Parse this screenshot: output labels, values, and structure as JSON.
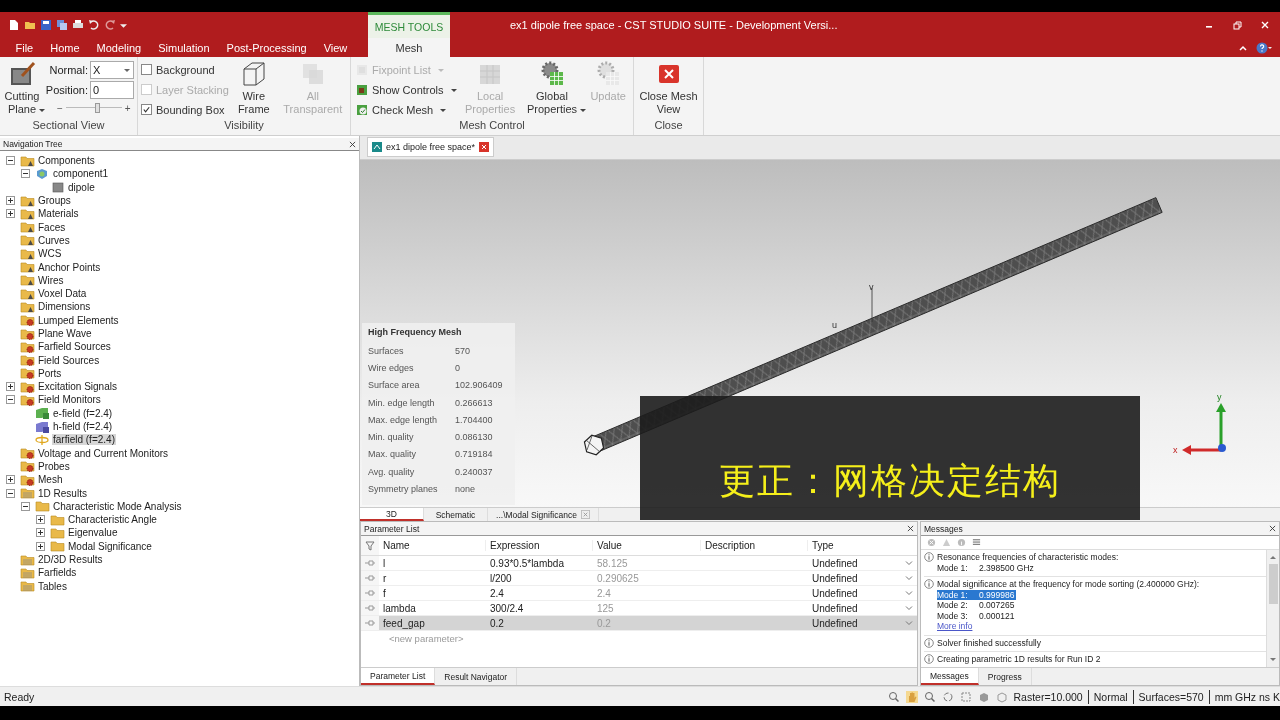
{
  "window": {
    "title": "ex1 dipole free space - CST STUDIO SUITE - Development Versi..."
  },
  "ribbon_tabs": [
    {
      "label": "File",
      "selected": false
    },
    {
      "label": "Home",
      "selected": false
    },
    {
      "label": "Modeling",
      "selected": false
    },
    {
      "label": "Simulation",
      "selected": false
    },
    {
      "label": "Post-Processing",
      "selected": false
    },
    {
      "label": "View",
      "selected": false
    }
  ],
  "contextual_group": {
    "label": "MESH TOOLS",
    "tabs": [
      {
        "label": "Mesh",
        "selected": true
      }
    ]
  },
  "ribbon": [
    {
      "label": "Sectional View",
      "items": [
        {
          "kind": "large-button",
          "label": "Cutting Plane",
          "menu": true,
          "disabled": false
        },
        {
          "kind": "field",
          "label": "Normal:",
          "value": "X",
          "menu": true
        },
        {
          "kind": "field",
          "label": "Position:",
          "value": "0",
          "menu": false
        },
        {
          "kind": "slider",
          "decrease": "−",
          "increase": "+",
          "level": 0.55
        }
      ]
    },
    {
      "label": "Visibility",
      "items": [
        {
          "kind": "checkbox",
          "label": "Background",
          "checked": false,
          "disabled": false
        },
        {
          "kind": "checkbox",
          "label": "Layer Stacking",
          "checked": false,
          "disabled": true
        },
        {
          "kind": "checkbox",
          "label": "Bounding Box",
          "checked": true,
          "disabled": false
        },
        {
          "kind": "large-button",
          "label": "Wire Frame",
          "menu": false,
          "disabled": false
        },
        {
          "kind": "large-button",
          "label": "All Transparent",
          "menu": false,
          "disabled": true
        }
      ]
    },
    {
      "label": "Mesh Control",
      "items": [
        {
          "kind": "small-button",
          "label": "Fixpoint List",
          "menu": true,
          "disabled": true
        },
        {
          "kind": "small-button",
          "label": "Show Controls",
          "menu": true,
          "disabled": false
        },
        {
          "kind": "small-button",
          "label": "Check Mesh",
          "menu": true,
          "disabled": false
        },
        {
          "kind": "large-button",
          "label": "Local Properties",
          "menu": false,
          "disabled": true
        },
        {
          "kind": "large-button",
          "label": "Global Properties",
          "menu": true,
          "disabled": false
        },
        {
          "kind": "large-button",
          "label": "Update",
          "menu": false,
          "disabled": true
        }
      ]
    },
    {
      "label": "Close",
      "items": [
        {
          "kind": "large-button",
          "label": "Close Mesh View",
          "menu": false,
          "disabled": false
        }
      ]
    }
  ],
  "navigation_tree": {
    "title": "Navigation Tree",
    "items": [
      {
        "label": "Components",
        "kind": "folder",
        "expanded": true,
        "selected": false,
        "children": [
          {
            "label": "component1",
            "kind": "component",
            "expanded": true,
            "selected": false,
            "children": [
              {
                "label": "dipole",
                "kind": "solid",
                "selected": false
              }
            ]
          }
        ]
      },
      {
        "label": "Groups",
        "kind": "folder",
        "expanded": false,
        "selected": false
      },
      {
        "label": "Materials",
        "kind": "folder",
        "expanded": false,
        "selected": false
      },
      {
        "label": "Faces",
        "kind": "folder",
        "selected": false
      },
      {
        "label": "Curves",
        "kind": "folder",
        "selected": false
      },
      {
        "label": "WCS",
        "kind": "folder",
        "selected": false
      },
      {
        "label": "Anchor Points",
        "kind": "folder",
        "selected": false
      },
      {
        "label": "Wires",
        "kind": "folder",
        "selected": false
      },
      {
        "label": "Voxel Data",
        "kind": "folder",
        "selected": false
      },
      {
        "label": "Dimensions",
        "kind": "folder",
        "selected": false
      },
      {
        "label": "Lumped Elements",
        "kind": "source-folder",
        "selected": false
      },
      {
        "label": "Plane Wave",
        "kind": "source-folder",
        "selected": false
      },
      {
        "label": "Farfield Sources",
        "kind": "source-folder",
        "selected": false
      },
      {
        "label": "Field Sources",
        "kind": "source-folder",
        "selected": false
      },
      {
        "label": "Ports",
        "kind": "source-folder",
        "selected": false
      },
      {
        "label": "Excitation Signals",
        "kind": "source-folder",
        "expanded": false,
        "selected": false
      },
      {
        "label": "Field Monitors",
        "kind": "source-folder",
        "expanded": true,
        "selected": false,
        "children": [
          {
            "label": "e-field (f=2.4)",
            "kind": "e-monitor",
            "selected": false
          },
          {
            "label": "h-field (f=2.4)",
            "kind": "h-monitor",
            "selected": false
          },
          {
            "label": "farfield (f=2.4)",
            "kind": "farfield-monitor",
            "selected": true
          }
        ]
      },
      {
        "label": "Voltage and Current Monitors",
        "kind": "source-folder",
        "selected": false
      },
      {
        "label": "Probes",
        "kind": "source-folder",
        "selected": false
      },
      {
        "label": "Mesh",
        "kind": "source-folder",
        "expanded": false,
        "selected": false
      },
      {
        "label": "1D Results",
        "kind": "result-folder",
        "expanded": true,
        "selected": false,
        "children": [
          {
            "label": "Characteristic Mode Analysis",
            "kind": "plain-folder",
            "expanded": true,
            "selected": false,
            "children": [
              {
                "label": "Characteristic Angle",
                "kind": "plain-folder",
                "expanded": false,
                "selected": false
              },
              {
                "label": "Eigenvalue",
                "kind": "plain-folder",
                "expanded": false,
                "selected": false
              },
              {
                "label": "Modal Significance",
                "kind": "plain-folder",
                "expanded": false,
                "selected": false
              }
            ]
          }
        ]
      },
      {
        "label": "2D/3D Results",
        "kind": "result-folder",
        "selected": false
      },
      {
        "label": "Farfields",
        "kind": "result-folder",
        "selected": false
      },
      {
        "label": "Tables",
        "kind": "result-folder",
        "selected": false
      }
    ]
  },
  "document_tabs": [
    {
      "label": "ex1 dipole free space*",
      "selected": true
    }
  ],
  "viewport": {
    "mesh_info": {
      "title": "High Frequency Mesh",
      "rows": [
        {
          "label": "Surfaces",
          "value": "570"
        },
        {
          "label": "Wire edges",
          "value": "0"
        },
        {
          "label": "Surface area",
          "value": "102.906409"
        },
        {
          "label": "Min. edge length",
          "value": "0.266613"
        },
        {
          "label": "Max. edge length",
          "value": "1.704400"
        },
        {
          "label": "Min. quality",
          "value": "0.086130"
        },
        {
          "label": "Max. quality",
          "value": "0.719184"
        },
        {
          "label": "Avg. quality",
          "value": "0.240037"
        },
        {
          "label": "Symmetry planes",
          "value": "none"
        }
      ]
    },
    "local_axis_labels": [
      "v",
      "u"
    ],
    "axis_labels": [
      "x",
      "y"
    ]
  },
  "view_tabs": [
    {
      "label": "3D",
      "selected": true,
      "closable": false
    },
    {
      "label": "Schematic",
      "selected": false,
      "closable": false
    },
    {
      "label": "...\\Modal Significance",
      "selected": false,
      "closable": true
    }
  ],
  "parameter_list": {
    "title": "Parameter List",
    "columns": [
      "Name",
      "Expression",
      "Value",
      "Description",
      "Type"
    ],
    "rows": [
      {
        "name": "l",
        "expression": "0.93*0.5*lambda",
        "value": "58.125",
        "type": "Undefined",
        "selected": false
      },
      {
        "name": "r",
        "expression": "l/200",
        "value": "0.290625",
        "type": "Undefined",
        "selected": false
      },
      {
        "name": "f",
        "expression": "2.4",
        "value": "2.4",
        "type": "Undefined",
        "selected": false
      },
      {
        "name": "lambda",
        "expression": "300/2.4",
        "value": "125",
        "type": "Undefined",
        "selected": false
      },
      {
        "name": "feed_gap",
        "expression": "0.2",
        "value": "0.2",
        "type": "Undefined",
        "selected": true
      }
    ],
    "new_row_placeholder": "<new parameter>",
    "tabs": [
      {
        "label": "Parameter List",
        "selected": true
      },
      {
        "label": "Result Navigator",
        "selected": false
      }
    ]
  },
  "messages": {
    "title": "Messages",
    "entries": [
      {
        "text": "Resonance frequencies of characteristic modes:",
        "lines": [
          {
            "label": "Mode 1:",
            "value": "2.398500 GHz",
            "selected": false
          }
        ]
      },
      {
        "text": "Modal significance at the frequency for mode sorting (2.400000 GHz):",
        "lines": [
          {
            "label": "Mode 1:",
            "value": "0.999986",
            "selected": true
          },
          {
            "label": "Mode 2:",
            "value": "0.007265",
            "selected": false
          },
          {
            "label": "Mode 3:",
            "value": "0.000121",
            "selected": false
          }
        ],
        "link": "More info"
      },
      {
        "text": "Solver finished successfully"
      },
      {
        "text": "Creating parametric 1D results for Run ID 2"
      }
    ],
    "tabs": [
      {
        "label": "Messages",
        "selected": true
      },
      {
        "label": "Progress",
        "selected": false
      }
    ]
  },
  "status_bar": {
    "message": "Ready",
    "fields": [
      "Raster=10.000",
      "Normal",
      "Surfaces=570",
      "mm GHz ns K"
    ]
  },
  "caption": {
    "text": "更正：网格决定结构"
  }
}
